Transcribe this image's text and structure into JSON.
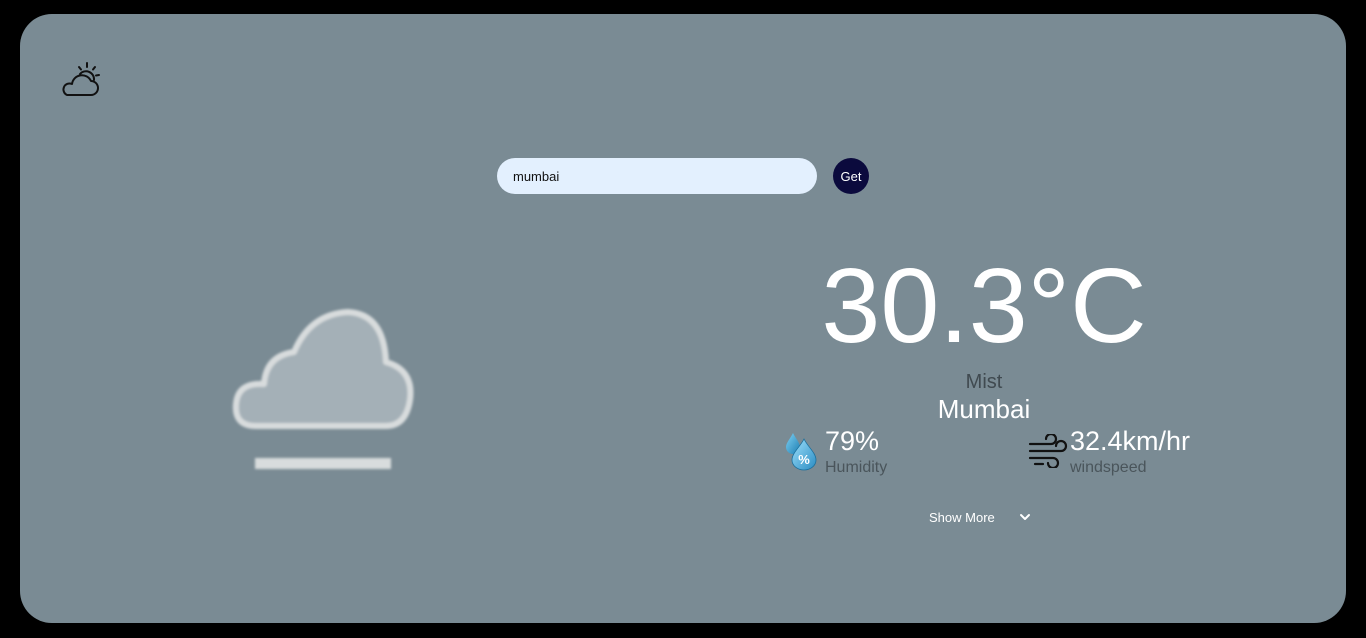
{
  "app": {
    "logo_icon": "partly-cloudy-icon"
  },
  "search": {
    "value": "mumbai",
    "button_label": "Get"
  },
  "current": {
    "illustration_icon": "mist-cloud-icon",
    "temperature": "30.3°C",
    "condition": "Mist",
    "city": "Mumbai"
  },
  "stats": {
    "humidity": {
      "icon": "humidity-drop-icon",
      "value": "79%",
      "label": "Humidity"
    },
    "wind": {
      "icon": "wind-icon",
      "value": "32.4km/hr",
      "label": "windspeed"
    }
  },
  "show_more": {
    "label": "Show More",
    "icon": "chevron-down-icon"
  },
  "colors": {
    "page_background": "#000000",
    "card_background": "#7a8b94",
    "input_background": "#e3f0fe",
    "button_background": "#0b0a3d",
    "primary_text": "#ffffff",
    "muted_text": "#4a555b"
  }
}
